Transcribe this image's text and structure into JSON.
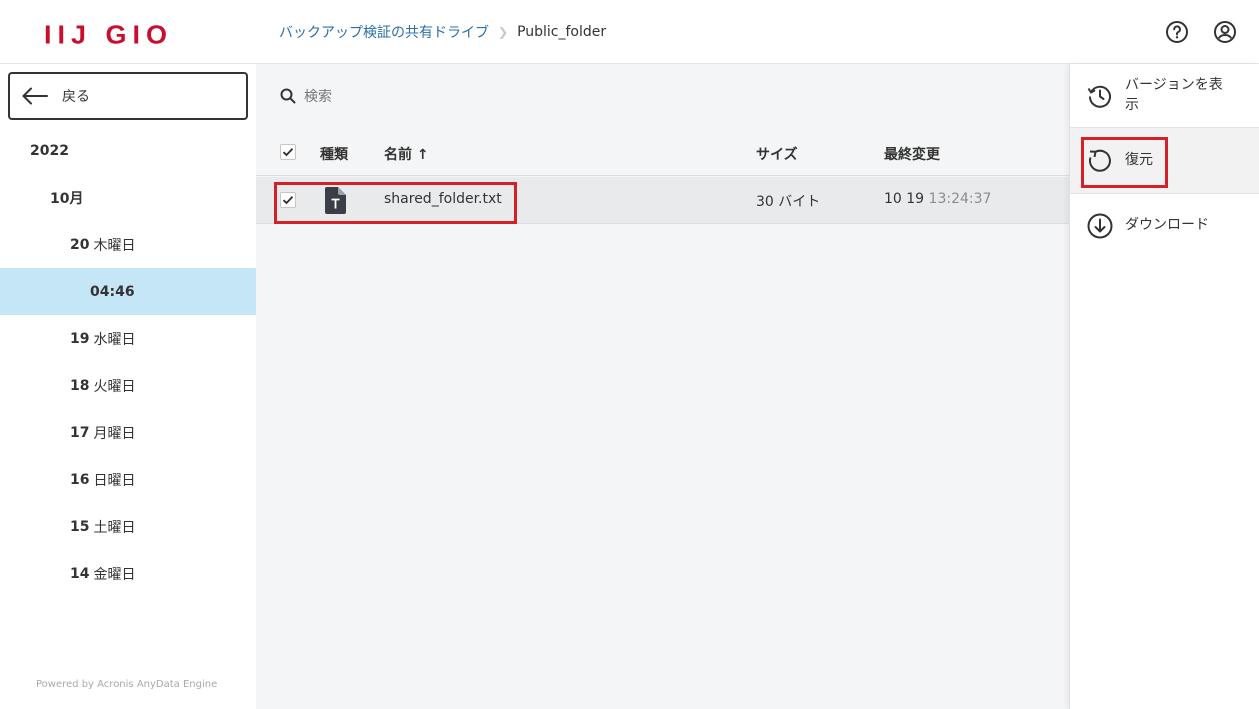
{
  "header": {
    "logo": "IIJ GIO",
    "breadcrumb": {
      "parent": "バックアップ検証の共有ドライブ",
      "current": "Public_folder"
    },
    "icons": [
      "help-icon",
      "account-icon"
    ]
  },
  "sidebar": {
    "back_label": "戻る",
    "tree": [
      {
        "num": "2022",
        "label": ""
      },
      {
        "num": "10月",
        "label": ""
      },
      {
        "num": "20",
        "label": "木曜日"
      },
      {
        "num": "04:46",
        "label": "",
        "selected": true
      },
      {
        "num": "19",
        "label": "水曜日"
      },
      {
        "num": "18",
        "label": "火曜日"
      },
      {
        "num": "17",
        "label": "月曜日"
      },
      {
        "num": "16",
        "label": "日曜日"
      },
      {
        "num": "15",
        "label": "土曜日"
      },
      {
        "num": "14",
        "label": "金曜日"
      }
    ],
    "powered_by": "Powered by Acronis AnyData Engine"
  },
  "main": {
    "search_placeholder": "検索",
    "columns": {
      "type": "種類",
      "name": "名前 ↑",
      "size": "サイズ",
      "modified": "最終変更"
    },
    "rows": [
      {
        "checked": true,
        "type_icon": "text-file-icon",
        "name": "shared_folder.txt",
        "size": "30 バイト",
        "date": "10 19",
        "time": "13:24:37"
      }
    ]
  },
  "actions": [
    {
      "label": "バージョンを表示",
      "icon": "history-icon"
    },
    {
      "label": "復元",
      "icon": "restore-icon",
      "selected": true
    },
    {
      "label": "ダウンロード",
      "icon": "download-icon"
    }
  ],
  "colors": {
    "brand": "#c8102e",
    "link": "#2a6fa8",
    "selected_bg": "#c5e6f7",
    "highlight": "#d3212a"
  }
}
